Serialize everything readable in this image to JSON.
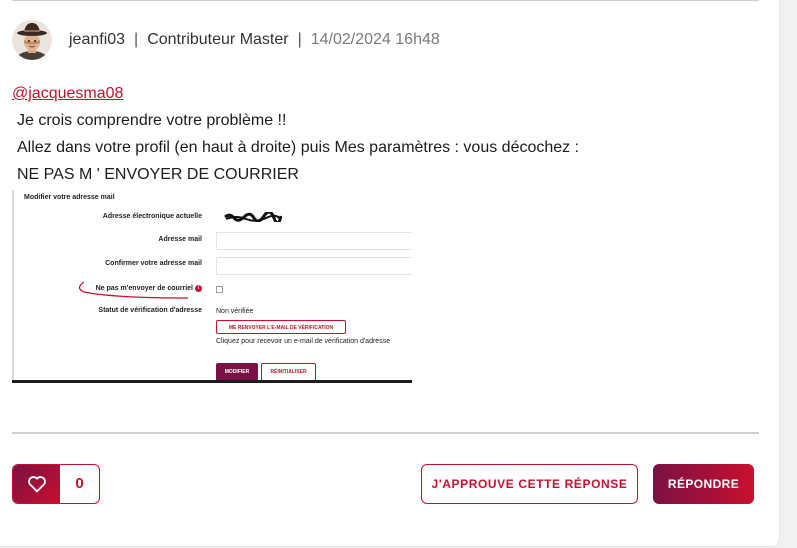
{
  "post": {
    "author": "jeanfi03",
    "rank": "Contributeur Master",
    "timestamp": "14/02/2024 16h48",
    "separator": "|",
    "mention": "@jacquesma08",
    "lines": [
      "Je crois comprendre votre problème !!",
      "Allez dans votre profil (en haut à droite) puis Mes paramètres : vous décochez :",
      "NE PAS M ' ENVOYER DE COURRIER"
    ]
  },
  "embedded_screenshot": {
    "heading": "Modifier votre adresse mail",
    "current_email_label": "Adresse électronique actuelle",
    "email_label": "Adresse mail",
    "confirm_email_label": "Confirmer votre adresse mail",
    "no_mail_label": "Ne pas m'envoyer de courriel",
    "status_label": "Statut de vérification d'adresse",
    "status_value": "Non vérifiée",
    "resend_button": "ME RENVOYER L'E-MAIL DE VÉRIFICATION",
    "resend_help": "Cliquez pour recevoir un e-mail de vérification d'adresse",
    "modify_button": "MODIFIER",
    "reset_button": "RÉINITIALISER",
    "info_glyph": "i"
  },
  "actions": {
    "like_icon": "heart-icon",
    "like_count": "0",
    "approve_label": "J'APPROUVE CETTE RÉPONSE",
    "reply_label": "RÉPONDRE"
  },
  "colors": {
    "accent": "#c8102e",
    "accent_dark": "#7a1145",
    "text": "#1c1c1c",
    "muted": "#7a7a7a"
  }
}
